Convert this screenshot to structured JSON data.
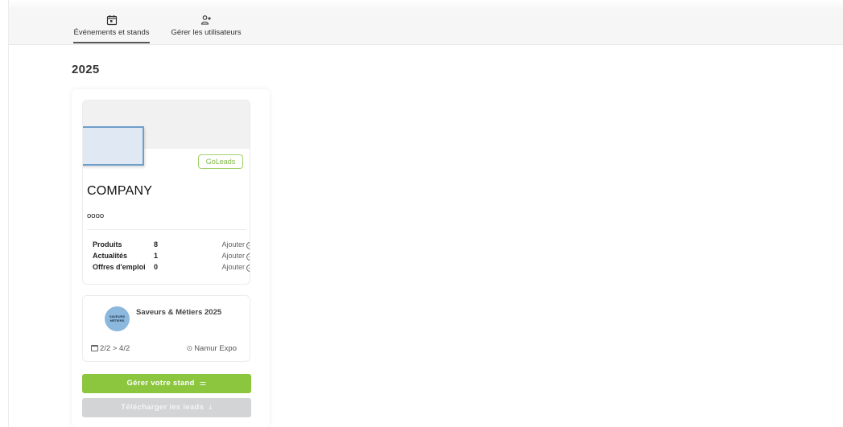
{
  "nav": {
    "tabs": [
      {
        "label": "Événements et stands",
        "icon": "calendar-icon",
        "active": true
      },
      {
        "label": "Gérer les utilisateurs",
        "icon": "users-icon",
        "active": false
      }
    ]
  },
  "year_heading": "2025",
  "stand_card": {
    "badge": "GoLeads",
    "company_name": "COMPANY",
    "company_subtitle": "oooo",
    "stats": [
      {
        "label": "Produits",
        "count": "8",
        "action": "Ajouter"
      },
      {
        "label": "Actualités",
        "count": "1",
        "action": "Ajouter"
      },
      {
        "label": "Offres d'emploi",
        "count": "0",
        "action": "Ajouter"
      }
    ],
    "event": {
      "name": "Saveurs & Métiers 2025",
      "logo_text_line1": "SAVEURS",
      "logo_text_line2": "MÉTIERS",
      "dates": "2/2 > 4/2",
      "location": "Namur Expo"
    },
    "manage_button": "Gérer votre stand",
    "download_button": "Télécharger les leads"
  },
  "colors": {
    "accent_green": "#8cc63f",
    "badge_green": "#7db843",
    "disabled_gray": "#d2d4d6"
  }
}
